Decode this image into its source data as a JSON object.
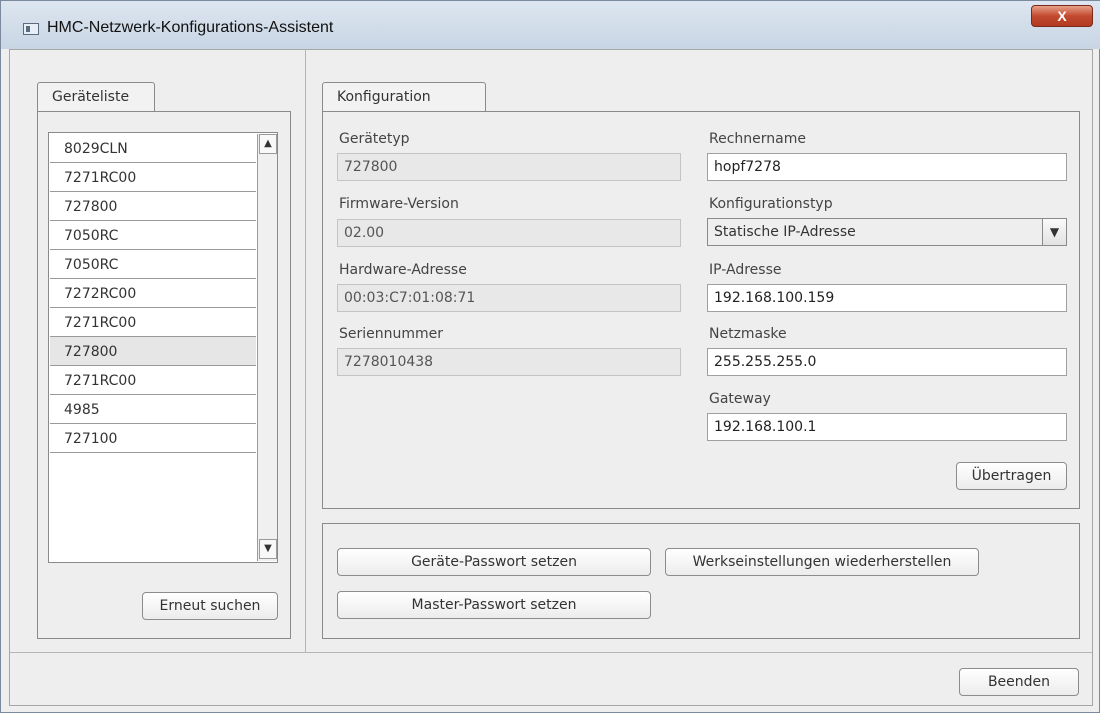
{
  "window": {
    "title": "HMC-Netzwerk-Konfigurations-Assistent",
    "close_label": "X"
  },
  "device_list": {
    "tab_label": "Geräteliste",
    "items": [
      "8029CLN",
      "7271RC00",
      "727800",
      "7050RC",
      "7050RC",
      "7272RC00",
      "7271RC00",
      "727800",
      "7271RC00",
      "4985",
      "727100"
    ],
    "selected_index": 7,
    "rescan_label": "Erneut suchen"
  },
  "config": {
    "tab_label": "Konfiguration",
    "device_type_label": "Gerätetyp",
    "device_type_value": "727800",
    "firmware_label": "Firmware-Version",
    "firmware_value": "02.00",
    "hw_address_label": "Hardware-Adresse",
    "hw_address_value": "00:03:C7:01:08:71",
    "serial_label": "Seriennummer",
    "serial_value": "7278010438",
    "hostname_label": "Rechnername",
    "hostname_value": "hopf7278",
    "config_type_label": "Konfigurationstyp",
    "config_type_value": "Statische IP-Adresse",
    "ip_label": "IP-Adresse",
    "ip_value": "192.168.100.159",
    "netmask_label": "Netzmaske",
    "netmask_value": "255.255.255.0",
    "gateway_label": "Gateway",
    "gateway_value": "192.168.100.1",
    "transfer_label": "Übertragen"
  },
  "actions": {
    "device_password_label": "Geräte-Passwort setzen",
    "factory_reset_label": "Werkseinstellungen wiederherstellen",
    "master_password_label": "Master-Passwort setzen"
  },
  "footer": {
    "exit_label": "Beenden"
  }
}
